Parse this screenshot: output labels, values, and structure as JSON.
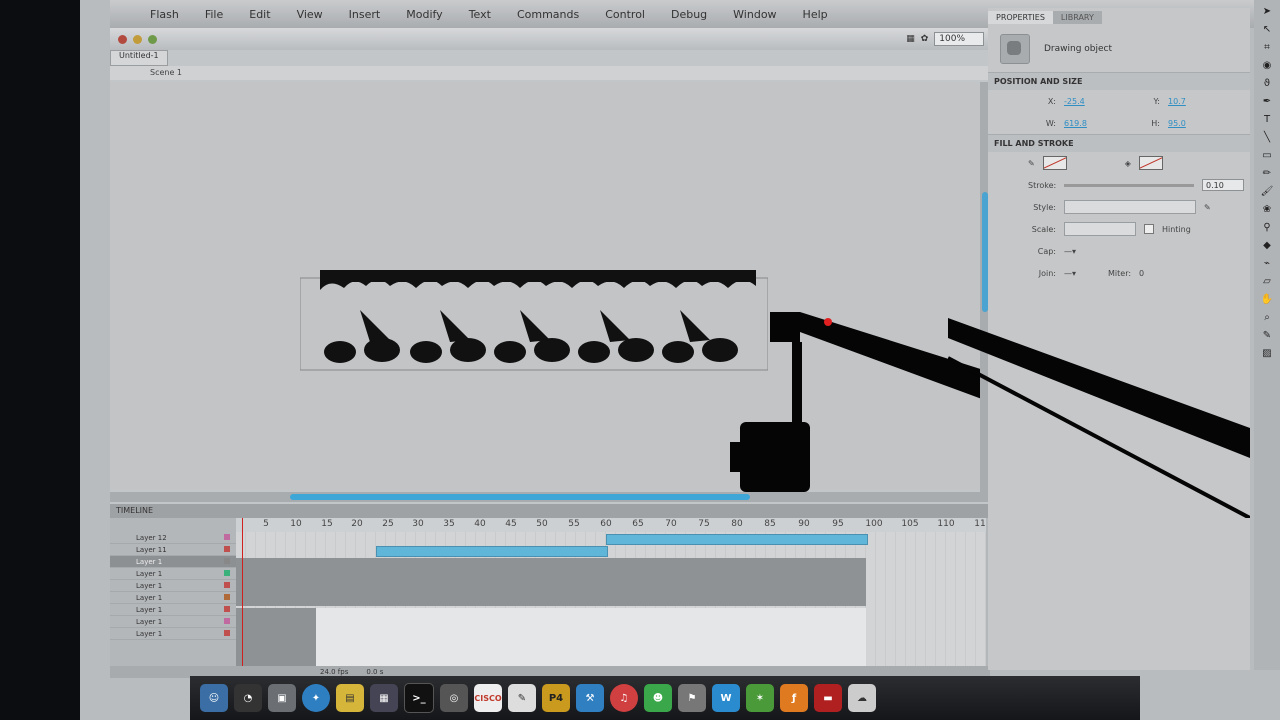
{
  "menu": [
    "Flash",
    "File",
    "Edit",
    "View",
    "Insert",
    "Modify",
    "Text",
    "Commands",
    "Control",
    "Debug",
    "Window",
    "Help"
  ],
  "window": {
    "zoom": "100%"
  },
  "document": {
    "tab": "Untitled-1",
    "scene": "Scene 1"
  },
  "timeline": {
    "tabs": "TIMELINE",
    "frame_numbers": [
      "5",
      "10",
      "15",
      "20",
      "25",
      "30",
      "35",
      "40",
      "45",
      "50",
      "55",
      "60",
      "65",
      "70",
      "75",
      "80",
      "85",
      "90",
      "95",
      "100",
      "105",
      "110",
      "11"
    ],
    "layers": [
      "Layer 12",
      "Layer 11",
      "Layer 1",
      "Layer 1",
      "Layer 1",
      "Layer 1",
      "Layer 1",
      "Layer 1",
      "Layer 1"
    ],
    "status": {
      "fps": "24.0 fps",
      "time": "0.0 s"
    }
  },
  "properties": {
    "tab": "PROPERTIES",
    "tab2": "LIBRARY",
    "object_type": "Drawing object",
    "position_section": "POSITION AND SIZE",
    "x_label": "X:",
    "x_value": "-25.4",
    "y_label": "Y:",
    "y_value": "10.7",
    "w_label": "W:",
    "w_value": "619.8",
    "h_label": "H:",
    "h_value": "95.0",
    "fill_section": "FILL AND STROKE",
    "stroke_label": "Stroke:",
    "stroke_value": "0.10",
    "style_label": "Style:",
    "scale_label": "Scale:",
    "hinting_label": "Hinting",
    "cap_label": "Cap:",
    "join_label": "Join:",
    "miter_label": "Miter:",
    "miter_value": "0"
  },
  "dock_icons": [
    "finder",
    "dashboard",
    "preview",
    "safari",
    "stickies",
    "exposé",
    "terminal",
    "screenshot",
    "cisco",
    "textedit",
    "P4",
    "xcode",
    "itunes",
    "ichat",
    "directory",
    "ftp",
    "dreamweaver",
    "flash",
    "pdf",
    "misc"
  ],
  "dock_labels": {
    "cisco": "CISCO",
    "p4": "P4"
  },
  "colors": {
    "accent": "#3ea7d8",
    "playhead": "#d02020"
  }
}
